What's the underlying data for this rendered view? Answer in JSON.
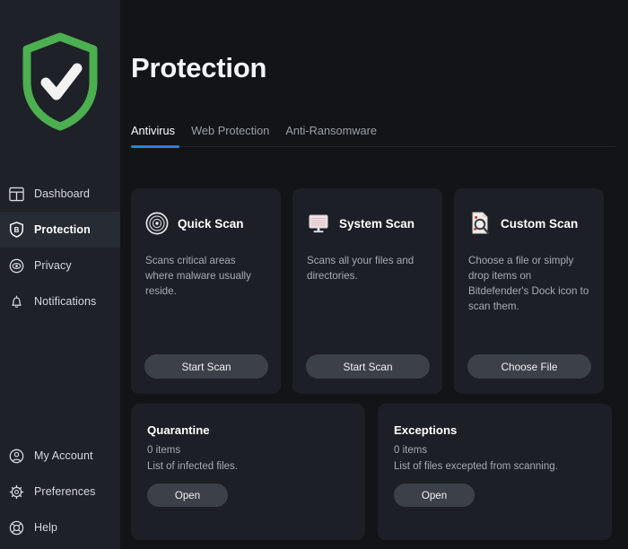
{
  "app": {
    "logo_icon": "shield-check-icon",
    "logo_color": "#4caf50",
    "accent_color": "#2f7fd6",
    "sidebar_bg": "#1e2127",
    "main_bg": "#121418",
    "card_bg": "#1c1f25",
    "button_bg": "#3c4049"
  },
  "sidebar": {
    "top_items": [
      {
        "label": "Dashboard",
        "icon": "dashboard-grid-icon",
        "active": false
      },
      {
        "label": "Protection",
        "icon": "shield-b-icon",
        "active": true
      },
      {
        "label": "Privacy",
        "icon": "eye-circle-icon",
        "active": false
      },
      {
        "label": "Notifications",
        "icon": "bell-icon",
        "active": false
      }
    ],
    "bottom_items": [
      {
        "label": "My Account",
        "icon": "user-circle-icon"
      },
      {
        "label": "Preferences",
        "icon": "gear-icon"
      },
      {
        "label": "Help",
        "icon": "lifebuoy-icon"
      }
    ]
  },
  "header": {
    "title": "Protection"
  },
  "tabs": [
    {
      "label": "Antivirus",
      "active": true
    },
    {
      "label": "Web Protection",
      "active": false
    },
    {
      "label": "Anti-Ransomware",
      "active": false
    }
  ],
  "scan_cards": [
    {
      "title": "Quick Scan",
      "icon": "radar-target-icon",
      "description": "Scans critical areas where malware usually reside.",
      "button": "Start Scan"
    },
    {
      "title": "System Scan",
      "icon": "monitor-icon",
      "description": "Scans all your files and directories.",
      "button": "Start Scan"
    },
    {
      "title": "Custom Scan",
      "icon": "document-magnifier-icon",
      "description": "Choose a file or simply drop items on Bitdefender's Dock icon to scan them.",
      "button": "Choose File"
    }
  ],
  "info_cards": [
    {
      "title": "Quarantine",
      "count": "0 items",
      "subtitle": "List of infected files.",
      "button": "Open"
    },
    {
      "title": "Exceptions",
      "count": "0 items",
      "subtitle": "List of files excepted from scanning.",
      "button": "Open"
    }
  ]
}
